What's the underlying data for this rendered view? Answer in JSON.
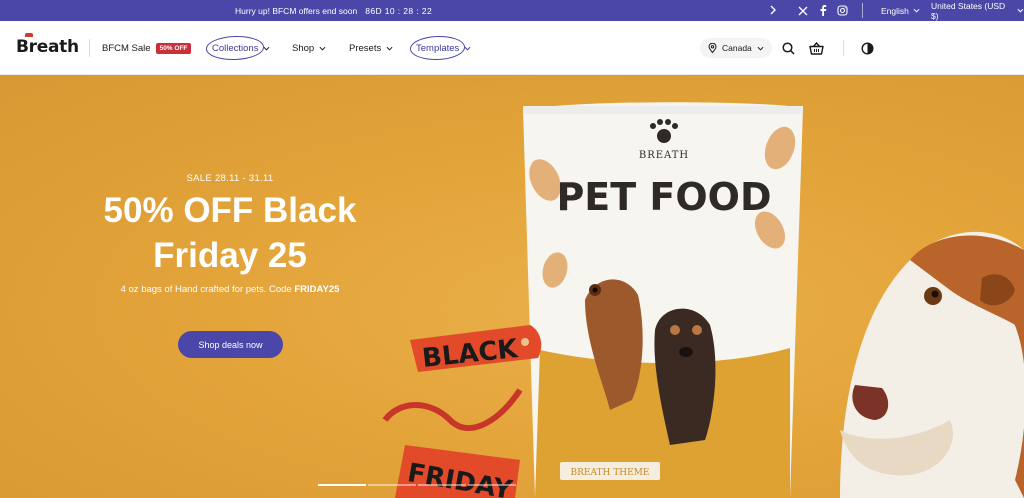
{
  "announcement": {
    "promo_text": "Hurry up! BFCM offers end soon",
    "countdown": "86D  10 : 28 : 22",
    "language": "English",
    "currency": "United States (USD $)",
    "social_icons": [
      "x-icon",
      "facebook-icon",
      "instagram-icon"
    ]
  },
  "header": {
    "logo": "Breath",
    "nav": [
      {
        "label": "BFCM Sale",
        "badge": "50% OFF"
      },
      {
        "label": "Collections",
        "has_dropdown": true,
        "highlighted": true
      },
      {
        "label": "Shop",
        "has_dropdown": true
      },
      {
        "label": "Presets",
        "has_dropdown": true
      },
      {
        "label": "Templates",
        "has_dropdown": true,
        "highlighted": true
      }
    ],
    "country": "Canada",
    "icons": [
      "location-icon",
      "search-icon",
      "cart-icon",
      "contrast-icon"
    ]
  },
  "hero": {
    "eyebrow": "SALE 28.11 - 31.11",
    "title_line1": "50% OFF Black",
    "title_line2": "Friday 25",
    "subtitle_prefix": "4 oz bags of Hand crafted for pets. Code ",
    "subtitle_code": "FRIDAY25",
    "cta_label": "Shop deals now",
    "slides": 4,
    "active_slide": 0,
    "image_text": {
      "brand": "BREATH",
      "product": "PET FOOD",
      "theme": "BREATH THEME",
      "tag_top": "BLACK",
      "tag_bottom": "FRIDAY"
    }
  },
  "colors": {
    "brand_purple": "#4a47a8",
    "hero_orange": "#e3a43a",
    "sale_red": "#c9303a"
  }
}
